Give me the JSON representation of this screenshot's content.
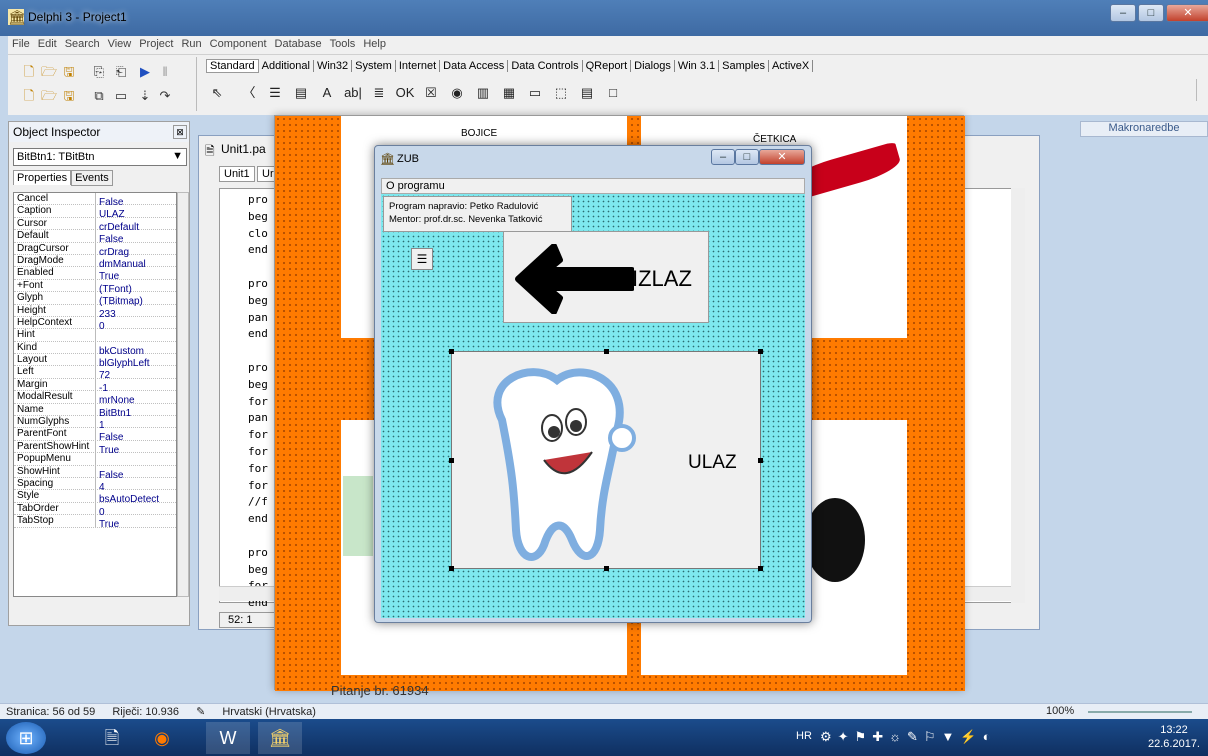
{
  "window": {
    "title": "Delphi 3 - Project1",
    "min": "–",
    "max": "□",
    "close": "✕"
  },
  "menu": [
    "File",
    "Edit",
    "Search",
    "View",
    "Project",
    "Run",
    "Component",
    "Database",
    "Tools",
    "Help"
  ],
  "palette": {
    "tabs": [
      "Standard",
      "Additional",
      "Win32",
      "System",
      "Internet",
      "Data Access",
      "Data Controls",
      "QReport",
      "Dialogs",
      "Win 3.1",
      "Samples",
      "ActiveX"
    ],
    "selected_tab": "Standard",
    "icons": [
      "pointer-icon",
      "frames-icon",
      "mainmenu-icon",
      "popupmenu-icon",
      "label-icon",
      "edit-icon",
      "memo-icon",
      "button-icon",
      "checkbox-icon",
      "radiobutton-icon",
      "listbox-icon",
      "combobox-icon",
      "scrollbar-icon",
      "groupbox-icon",
      "radiogroup-icon",
      "panel-icon"
    ],
    "glyphs": [
      "⇖",
      "〈",
      "☰",
      "▤",
      "A",
      "ab|",
      "≣",
      "OK",
      "☒",
      "◉",
      "▥",
      "▦",
      "▭",
      "⬚",
      "▤",
      "□"
    ]
  },
  "right_strip": {
    "label": "Makronaredbe"
  },
  "object_inspector": {
    "title": "Object Inspector",
    "close": "⊠",
    "selected": "BitBtn1: TBitBtn",
    "tabs": [
      "Properties",
      "Events"
    ],
    "properties": [
      [
        "Cancel",
        "False"
      ],
      [
        "Caption",
        "ULAZ"
      ],
      [
        "Cursor",
        "crDefault"
      ],
      [
        "Default",
        "False"
      ],
      [
        "DragCursor",
        "crDrag"
      ],
      [
        "DragMode",
        "dmManual"
      ],
      [
        "Enabled",
        "True"
      ],
      [
        "+Font",
        "(TFont)"
      ],
      [
        "Glyph",
        "(TBitmap)"
      ],
      [
        "Height",
        "233"
      ],
      [
        "HelpContext",
        "0"
      ],
      [
        "Hint",
        ""
      ],
      [
        "Kind",
        "bkCustom"
      ],
      [
        "Layout",
        "blGlyphLeft"
      ],
      [
        "Left",
        "72"
      ],
      [
        "Margin",
        "-1"
      ],
      [
        "ModalResult",
        "mrNone"
      ],
      [
        "Name",
        "BitBtn1"
      ],
      [
        "NumGlyphs",
        "1"
      ],
      [
        "ParentFont",
        "False"
      ],
      [
        "ParentShowHint",
        "True"
      ],
      [
        "PopupMenu",
        ""
      ],
      [
        "ShowHint",
        "False"
      ],
      [
        "Spacing",
        "4"
      ],
      [
        "Style",
        "bsAutoDetect"
      ],
      [
        "TabOrder",
        "0"
      ],
      [
        "TabStop",
        "True"
      ]
    ]
  },
  "editor": {
    "caption": "Unit1.pa",
    "tabs": [
      "Unit1",
      "Ur"
    ],
    "code_lines": [
      "pro",
      "beg",
      "clo",
      "end",
      "",
      "pro",
      "beg",
      "pan",
      "end",
      "",
      "pro",
      "beg",
      "for",
      "pan",
      "for",
      "for",
      "for",
      "for",
      "//f",
      "end",
      "",
      "pro",
      "beg",
      "for",
      "end"
    ],
    "position": "52:  1"
  },
  "word_doc": {
    "col1": "BOJICE",
    "col2": "ČETKICA",
    "footer": "Pitanje br. 61934"
  },
  "form": {
    "caption": "ZUB",
    "menu": "O programu",
    "info_line1": "Program napravio: Petko Radulović",
    "info_line2": "Mentor:  prof.dr.sc. Nevenka Tatković",
    "exit_label": "IZLAZ",
    "enter_label": "ULAZ"
  },
  "statusbar": {
    "page": "Stranica: 56 od 59",
    "words": "Riječi: 10.936",
    "language": "Hrvatski (Hrvatska)",
    "zoom": "100%"
  },
  "taskbar": {
    "lang": "HR",
    "time": "13:22",
    "date": "22.6.2017."
  }
}
